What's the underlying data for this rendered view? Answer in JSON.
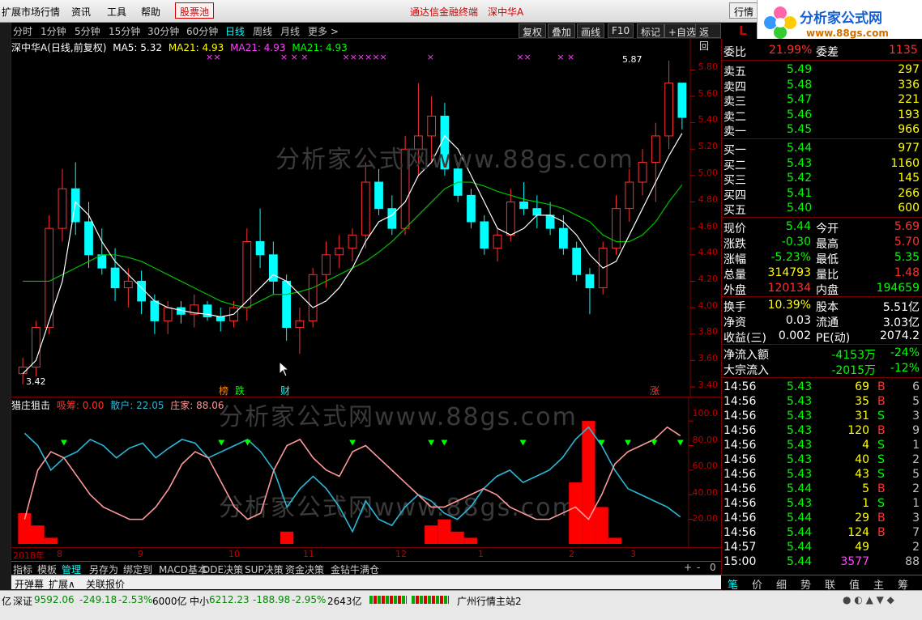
{
  "menubar": {
    "items": [
      "扩展市场行情",
      "资讯",
      "工具",
      "帮助"
    ],
    "stock_pool": "股票池",
    "center_app": "通达信金融终端",
    "center_stock": "深中华A",
    "quote_btn": "行情"
  },
  "logo": {
    "title": "分析家公式网",
    "url": "www.88gs.com"
  },
  "toolbar": {
    "periods": [
      "分时",
      "1分钟",
      "5分钟",
      "15分钟",
      "30分钟",
      "60分钟",
      "日线",
      "周线",
      "月线",
      "更多 >"
    ],
    "active": "日线",
    "right_buttons": [
      "复权",
      "叠加",
      "画线",
      "F10",
      "标记",
      "+自选",
      "返回"
    ]
  },
  "main_legend": {
    "name": "深中华A(日线,前复权)",
    "ma5": "MA5: 5.32",
    "ma21a": "MA21: 4.93",
    "ma21b": "MA21: 4.93",
    "ma21c": "MA21: 4.93"
  },
  "main_annotations": {
    "high": "5.87",
    "low": "3.42"
  },
  "main_yaxis": [
    "5.80",
    "5.60",
    "5.40",
    "5.20",
    "5.00",
    "4.80",
    "4.60",
    "4.40",
    "4.20",
    "4.00",
    "3.80",
    "3.60",
    "3.40"
  ],
  "badges": [
    {
      "text": "榜",
      "color": "#ff8800"
    },
    {
      "text": "跌",
      "color": "#00ff00"
    },
    {
      "text": "财",
      "color": "#00ffff"
    },
    {
      "text": "涨",
      "color": "#ff3030"
    }
  ],
  "sub_legend": {
    "name": "猎庄狙击",
    "xichou": "吸筹: 0.00",
    "sanhu": "散户: 22.05",
    "zhuangjia": "庄家: 88.06"
  },
  "sub_yaxis": [
    "100.0",
    "80.00",
    "60.00",
    "40.00",
    "20.00"
  ],
  "xaxis": [
    "2018年",
    "8",
    "9",
    "10",
    "11",
    "12",
    "1",
    "2",
    "3"
  ],
  "bottom_tabs": [
    "指标",
    "模板",
    "管理",
    "另存为",
    "绑定到",
    "MACD基本",
    "DDE决策",
    "SUP决策",
    "资金决策",
    "金钻牛满仓"
  ],
  "bottom_tabs_active": "管理",
  "bottom_controls": [
    "+",
    "-",
    "0"
  ],
  "bottom_tabs2": [
    "开弹幕",
    "扩展∧",
    "关联报价"
  ],
  "right_panel": {
    "header": "L",
    "weibi_label": "委比",
    "weibi_value": "21.99%",
    "weicha_label": "委差",
    "weicha_value": "1135",
    "asks": [
      {
        "label": "卖五",
        "price": "5.49",
        "vol": "297"
      },
      {
        "label": "卖四",
        "price": "5.48",
        "vol": "336"
      },
      {
        "label": "卖三",
        "price": "5.47",
        "vol": "221"
      },
      {
        "label": "卖二",
        "price": "5.46",
        "vol": "193"
      },
      {
        "label": "卖一",
        "price": "5.45",
        "vol": "966"
      }
    ],
    "bids": [
      {
        "label": "买一",
        "price": "5.44",
        "vol": "977"
      },
      {
        "label": "买二",
        "price": "5.43",
        "vol": "1160"
      },
      {
        "label": "买三",
        "price": "5.42",
        "vol": "145"
      },
      {
        "label": "买四",
        "price": "5.41",
        "vol": "266"
      },
      {
        "label": "买五",
        "price": "5.40",
        "vol": "600"
      }
    ],
    "quote": [
      {
        "l1": "现价",
        "v1": "5.44",
        "c1": "#00ff00",
        "l2": "今开",
        "v2": "5.69",
        "c2": "#ff3030"
      },
      {
        "l1": "涨跌",
        "v1": "-0.30",
        "c1": "#00ff00",
        "l2": "最高",
        "v2": "5.70",
        "c2": "#ff3030"
      },
      {
        "l1": "涨幅",
        "v1": "-5.23%",
        "c1": "#00ff00",
        "l2": "最低",
        "v2": "5.35",
        "c2": "#00ff00"
      },
      {
        "l1": "总量",
        "v1": "314793",
        "c1": "#ffff00",
        "l2": "量比",
        "v2": "1.48",
        "c2": "#ff3030"
      },
      {
        "l1": "外盘",
        "v1": "120134",
        "c1": "#ff3030",
        "l2": "内盘",
        "v2": "194659",
        "c2": "#00ff00"
      }
    ],
    "quote2": [
      {
        "l1": "换手",
        "v1": "10.39%",
        "c1": "#ffff00",
        "l2": "股本",
        "v2": "5.51亿",
        "c2": "#ffffff"
      },
      {
        "l1": "净资",
        "v1": "0.03",
        "c1": "#ffffff",
        "l2": "流通",
        "v2": "3.03亿",
        "c2": "#ffffff"
      },
      {
        "l1": "收益(三)",
        "v1": "0.002",
        "c1": "#ffffff",
        "l2": "PE(动)",
        "v2": "2074.2",
        "c2": "#ffffff"
      }
    ],
    "flow": [
      {
        "label": "净流入额",
        "value": "-4153万",
        "pct": "-24%"
      },
      {
        "label": "大宗流入",
        "value": "-2015万",
        "pct": "-12%"
      }
    ],
    "ticks": [
      {
        "t": "14:56",
        "p": "5.43",
        "v": "69",
        "s": "B",
        "n": "6"
      },
      {
        "t": "14:56",
        "p": "5.43",
        "v": "35",
        "s": "B",
        "n": "5"
      },
      {
        "t": "14:56",
        "p": "5.43",
        "v": "31",
        "s": "S",
        "n": "3"
      },
      {
        "t": "14:56",
        "p": "5.43",
        "v": "120",
        "s": "B",
        "n": "9"
      },
      {
        "t": "14:56",
        "p": "5.43",
        "v": "4",
        "s": "S",
        "n": "1"
      },
      {
        "t": "14:56",
        "p": "5.43",
        "v": "40",
        "s": "S",
        "n": "2"
      },
      {
        "t": "14:56",
        "p": "5.43",
        "v": "43",
        "s": "S",
        "n": "5"
      },
      {
        "t": "14:56",
        "p": "5.44",
        "v": "5",
        "s": "B",
        "n": "2"
      },
      {
        "t": "14:56",
        "p": "5.43",
        "v": "1",
        "s": "S",
        "n": "1"
      },
      {
        "t": "14:56",
        "p": "5.44",
        "v": "29",
        "s": "B",
        "n": "3"
      },
      {
        "t": "14:56",
        "p": "5.44",
        "v": "124",
        "s": "B",
        "n": "7"
      },
      {
        "t": "14:57",
        "p": "5.44",
        "v": "49",
        "s": "",
        "n": "2"
      },
      {
        "t": "15:00",
        "p": "5.44",
        "v": "3577",
        "s": "",
        "n": "88"
      }
    ],
    "tabs": [
      "笔",
      "价",
      "细",
      "势",
      "联",
      "值",
      "主",
      "筹"
    ]
  },
  "statusbar": {
    "prefix": "亿",
    "sz_label": "深证",
    "sz_value": "9592.06",
    "sz_chg": "-249.18",
    "sz_pct": "-2.53%",
    "sz_amt": "6000亿",
    "zx_label": "中小",
    "zx_value": "6212.23",
    "zx_chg": "-188.98",
    "zx_pct": "-2.95%",
    "zx_amt": "2643亿",
    "server": "广州行情主站2"
  },
  "watermarks": [
    "分析家公式网www.88gs.com",
    "分析家公式网www.88gs.com",
    "分析家公式网www.88gs.com"
  ],
  "chart_data": {
    "type": "candlestick",
    "colors": {
      "up": "#ff3030",
      "down": "#00ffff",
      "ma5": "#ffffff",
      "ma21": "#00c000",
      "retail": "#2ab8d8",
      "dealer": "#ff9999",
      "accum": "#ff0000",
      "signal": "#00ff00"
    },
    "ylim": [
      3.4,
      5.9
    ],
    "candles": [
      [
        3.5,
        3.42,
        3.62,
        3.55
      ],
      [
        3.55,
        3.48,
        3.9,
        3.85
      ],
      [
        3.85,
        3.8,
        4.7,
        4.6
      ],
      [
        4.6,
        4.5,
        5.05,
        4.9
      ],
      [
        4.9,
        4.55,
        5.1,
        4.65
      ],
      [
        4.65,
        4.3,
        4.8,
        4.4
      ],
      [
        4.4,
        4.25,
        4.6,
        4.3
      ],
      [
        4.3,
        4.05,
        4.45,
        4.15
      ],
      [
        4.15,
        4.0,
        4.3,
        4.2
      ],
      [
        4.2,
        3.95,
        4.28,
        4.05
      ],
      [
        4.05,
        3.8,
        4.1,
        3.9
      ],
      [
        3.9,
        3.8,
        4.05,
        4.0
      ],
      [
        4.0,
        3.88,
        4.05,
        3.95
      ],
      [
        3.95,
        3.85,
        4.1,
        4.02
      ],
      [
        4.02,
        3.9,
        4.05,
        3.93
      ],
      [
        3.93,
        3.82,
        4.0,
        3.9
      ],
      [
        3.9,
        3.85,
        4.05,
        4.0
      ],
      [
        4.0,
        3.9,
        4.6,
        4.5
      ],
      [
        4.5,
        4.3,
        4.75,
        4.4
      ],
      [
        4.4,
        4.1,
        4.5,
        4.2
      ],
      [
        4.2,
        3.75,
        4.25,
        3.85
      ],
      [
        3.85,
        3.65,
        4.0,
        3.9
      ],
      [
        3.9,
        3.85,
        4.3,
        4.25
      ],
      [
        4.25,
        4.15,
        4.5,
        4.4
      ],
      [
        4.4,
        4.3,
        4.55,
        4.45
      ],
      [
        4.45,
        4.35,
        4.6,
        4.55
      ],
      [
        4.55,
        4.45,
        5.1,
        4.95
      ],
      [
        4.95,
        4.7,
        5.05,
        4.75
      ],
      [
        4.75,
        4.55,
        4.85,
        4.6
      ],
      [
        4.6,
        4.55,
        5.3,
        5.2
      ],
      [
        5.2,
        5.0,
        5.7,
        5.3
      ],
      [
        5.3,
        5.1,
        5.6,
        5.45
      ],
      [
        5.45,
        5.0,
        5.55,
        5.05
      ],
      [
        5.05,
        4.8,
        5.1,
        4.85
      ],
      [
        4.85,
        4.6,
        4.9,
        4.65
      ],
      [
        4.65,
        4.4,
        4.7,
        4.45
      ],
      [
        4.45,
        4.35,
        4.6,
        4.55
      ],
      [
        4.55,
        4.5,
        4.9,
        4.8
      ],
      [
        4.8,
        4.7,
        4.95,
        4.75
      ],
      [
        4.75,
        4.6,
        4.85,
        4.7
      ],
      [
        4.7,
        4.55,
        4.8,
        4.6
      ],
      [
        4.6,
        4.4,
        4.7,
        4.45
      ],
      [
        4.45,
        4.2,
        4.5,
        4.25
      ],
      [
        4.25,
        3.95,
        4.3,
        4.15
      ],
      [
        4.15,
        4.1,
        4.5,
        4.45
      ],
      [
        4.45,
        4.4,
        4.85,
        4.75
      ],
      [
        4.75,
        4.65,
        5.05,
        4.95
      ],
      [
        4.95,
        4.85,
        5.2,
        5.1
      ],
      [
        5.1,
        4.8,
        5.4,
        5.3
      ],
      [
        5.3,
        5.2,
        5.87,
        5.7
      ],
      [
        5.7,
        5.35,
        5.7,
        5.44
      ]
    ],
    "ma5": [
      3.5,
      3.6,
      3.9,
      4.2,
      4.8,
      4.7,
      4.5,
      4.35,
      4.25,
      4.15,
      4.05,
      4.0,
      3.98,
      3.96,
      3.95,
      3.93,
      3.95,
      4.05,
      4.15,
      4.25,
      4.2,
      4.1,
      4.0,
      4.05,
      4.15,
      4.3,
      4.5,
      4.65,
      4.7,
      4.8,
      5.0,
      5.1,
      5.3,
      5.2,
      5.0,
      4.8,
      4.6,
      4.55,
      4.6,
      4.7,
      4.7,
      4.65,
      4.55,
      4.4,
      4.3,
      4.35,
      4.55,
      4.75,
      4.95,
      5.15,
      5.32
    ],
    "ma21": [
      4.2,
      4.2,
      4.2,
      4.25,
      4.3,
      4.35,
      4.4,
      4.4,
      4.38,
      4.35,
      4.3,
      4.25,
      4.2,
      4.15,
      4.1,
      4.05,
      4.02,
      4.0,
      4.05,
      4.1,
      4.1,
      4.12,
      4.15,
      4.2,
      4.25,
      4.3,
      4.35,
      4.42,
      4.5,
      4.6,
      4.7,
      4.8,
      4.9,
      4.95,
      4.95,
      4.92,
      4.88,
      4.85,
      4.82,
      4.8,
      4.78,
      4.75,
      4.7,
      4.65,
      4.55,
      4.5,
      4.5,
      4.55,
      4.65,
      4.8,
      4.93
    ],
    "sub_ylim": [
      0,
      110
    ],
    "retail": [
      90,
      80,
      60,
      70,
      75,
      85,
      80,
      70,
      78,
      82,
      70,
      78,
      85,
      82,
      70,
      75,
      80,
      85,
      75,
      60,
      30,
      45,
      55,
      45,
      30,
      10,
      35,
      20,
      15,
      30,
      40,
      35,
      25,
      20,
      30,
      45,
      55,
      60,
      50,
      55,
      60,
      70,
      85,
      95,
      80,
      60,
      45,
      40,
      35,
      30,
      22
    ],
    "dealer": [
      20,
      60,
      75,
      70,
      55,
      40,
      30,
      25,
      20,
      20,
      30,
      45,
      65,
      75,
      70,
      50,
      30,
      20,
      25,
      60,
      80,
      85,
      70,
      60,
      55,
      75,
      80,
      70,
      60,
      50,
      40,
      30,
      30,
      35,
      40,
      45,
      40,
      30,
      25,
      20,
      20,
      25,
      30,
      20,
      40,
      65,
      75,
      80,
      85,
      95,
      88
    ],
    "accum": [
      25,
      15,
      5,
      0,
      0,
      0,
      0,
      0,
      0,
      0,
      0,
      0,
      0,
      0,
      0,
      0,
      0,
      0,
      0,
      0,
      10,
      0,
      0,
      0,
      0,
      0,
      0,
      0,
      0,
      0,
      0,
      15,
      20,
      10,
      5,
      0,
      0,
      0,
      0,
      0,
      0,
      0,
      50,
      100,
      30,
      5,
      0,
      0,
      0,
      0,
      0
    ],
    "signals": [
      3,
      15,
      17,
      25,
      31,
      32,
      38,
      44,
      46,
      48,
      50
    ]
  }
}
